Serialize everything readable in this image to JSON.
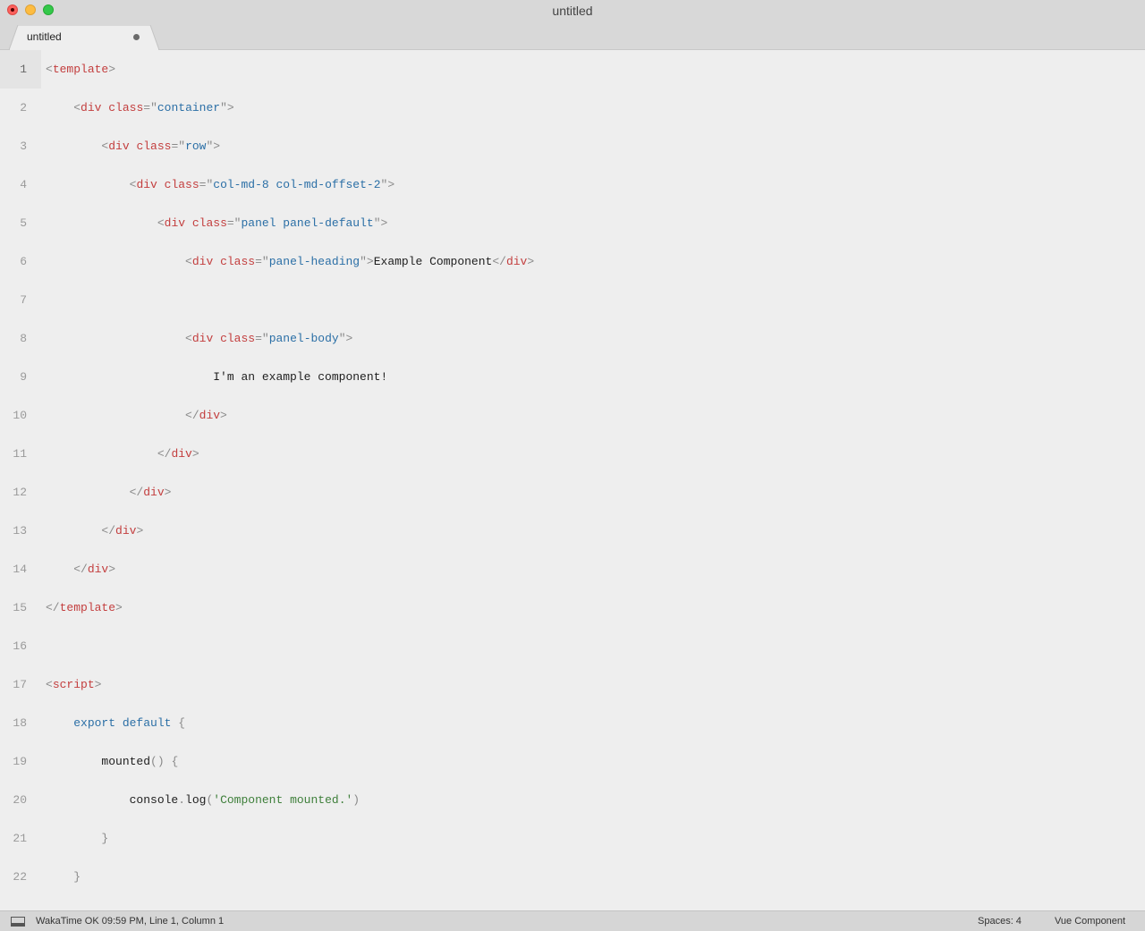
{
  "window": {
    "title": "untitled"
  },
  "tabs": [
    {
      "label": "untitled",
      "dirty": true
    }
  ],
  "code_lines": [
    {
      "n": "1",
      "tokens": [
        {
          "t": "<",
          "c": "punct"
        },
        {
          "t": "template",
          "c": "tag"
        },
        {
          "t": ">",
          "c": "punct"
        }
      ]
    },
    {
      "n": "2",
      "tokens": [
        {
          "t": "    ",
          "c": "txt"
        },
        {
          "t": "<",
          "c": "punct"
        },
        {
          "t": "div",
          "c": "tag"
        },
        {
          "t": " ",
          "c": "txt"
        },
        {
          "t": "class",
          "c": "attr"
        },
        {
          "t": "=\"",
          "c": "punct"
        },
        {
          "t": "container",
          "c": "str"
        },
        {
          "t": "\">",
          "c": "punct"
        }
      ]
    },
    {
      "n": "3",
      "tokens": [
        {
          "t": "        ",
          "c": "txt"
        },
        {
          "t": "<",
          "c": "punct"
        },
        {
          "t": "div",
          "c": "tag"
        },
        {
          "t": " ",
          "c": "txt"
        },
        {
          "t": "class",
          "c": "attr"
        },
        {
          "t": "=\"",
          "c": "punct"
        },
        {
          "t": "row",
          "c": "str"
        },
        {
          "t": "\">",
          "c": "punct"
        }
      ]
    },
    {
      "n": "4",
      "tokens": [
        {
          "t": "            ",
          "c": "txt"
        },
        {
          "t": "<",
          "c": "punct"
        },
        {
          "t": "div",
          "c": "tag"
        },
        {
          "t": " ",
          "c": "txt"
        },
        {
          "t": "class",
          "c": "attr"
        },
        {
          "t": "=\"",
          "c": "punct"
        },
        {
          "t": "col-md-8 col-md-offset-2",
          "c": "str"
        },
        {
          "t": "\">",
          "c": "punct"
        }
      ]
    },
    {
      "n": "5",
      "tokens": [
        {
          "t": "                ",
          "c": "txt"
        },
        {
          "t": "<",
          "c": "punct"
        },
        {
          "t": "div",
          "c": "tag"
        },
        {
          "t": " ",
          "c": "txt"
        },
        {
          "t": "class",
          "c": "attr"
        },
        {
          "t": "=\"",
          "c": "punct"
        },
        {
          "t": "panel panel-default",
          "c": "str"
        },
        {
          "t": "\">",
          "c": "punct"
        }
      ]
    },
    {
      "n": "6",
      "tokens": [
        {
          "t": "                    ",
          "c": "txt"
        },
        {
          "t": "<",
          "c": "punct"
        },
        {
          "t": "div",
          "c": "tag"
        },
        {
          "t": " ",
          "c": "txt"
        },
        {
          "t": "class",
          "c": "attr"
        },
        {
          "t": "=\"",
          "c": "punct"
        },
        {
          "t": "panel-heading",
          "c": "str"
        },
        {
          "t": "\">",
          "c": "punct"
        },
        {
          "t": "Example Component",
          "c": "txt"
        },
        {
          "t": "</",
          "c": "punct"
        },
        {
          "t": "div",
          "c": "tag"
        },
        {
          "t": ">",
          "c": "punct"
        }
      ]
    },
    {
      "n": "7",
      "tokens": []
    },
    {
      "n": "8",
      "tokens": [
        {
          "t": "                    ",
          "c": "txt"
        },
        {
          "t": "<",
          "c": "punct"
        },
        {
          "t": "div",
          "c": "tag"
        },
        {
          "t": " ",
          "c": "txt"
        },
        {
          "t": "class",
          "c": "attr"
        },
        {
          "t": "=\"",
          "c": "punct"
        },
        {
          "t": "panel-body",
          "c": "str"
        },
        {
          "t": "\">",
          "c": "punct"
        }
      ]
    },
    {
      "n": "9",
      "tokens": [
        {
          "t": "                        ",
          "c": "txt"
        },
        {
          "t": "I'm an example component!",
          "c": "txt"
        }
      ]
    },
    {
      "n": "10",
      "tokens": [
        {
          "t": "                    ",
          "c": "txt"
        },
        {
          "t": "</",
          "c": "punct"
        },
        {
          "t": "div",
          "c": "tag"
        },
        {
          "t": ">",
          "c": "punct"
        }
      ]
    },
    {
      "n": "11",
      "tokens": [
        {
          "t": "                ",
          "c": "txt"
        },
        {
          "t": "</",
          "c": "punct"
        },
        {
          "t": "div",
          "c": "tag"
        },
        {
          "t": ">",
          "c": "punct"
        }
      ]
    },
    {
      "n": "12",
      "tokens": [
        {
          "t": "            ",
          "c": "txt"
        },
        {
          "t": "</",
          "c": "punct"
        },
        {
          "t": "div",
          "c": "tag"
        },
        {
          "t": ">",
          "c": "punct"
        }
      ]
    },
    {
      "n": "13",
      "tokens": [
        {
          "t": "        ",
          "c": "txt"
        },
        {
          "t": "</",
          "c": "punct"
        },
        {
          "t": "div",
          "c": "tag"
        },
        {
          "t": ">",
          "c": "punct"
        }
      ]
    },
    {
      "n": "14",
      "tokens": [
        {
          "t": "    ",
          "c": "txt"
        },
        {
          "t": "</",
          "c": "punct"
        },
        {
          "t": "div",
          "c": "tag"
        },
        {
          "t": ">",
          "c": "punct"
        }
      ]
    },
    {
      "n": "15",
      "tokens": [
        {
          "t": "</",
          "c": "punct"
        },
        {
          "t": "template",
          "c": "tag"
        },
        {
          "t": ">",
          "c": "punct"
        }
      ]
    },
    {
      "n": "16",
      "tokens": []
    },
    {
      "n": "17",
      "tokens": [
        {
          "t": "<",
          "c": "punct"
        },
        {
          "t": "script",
          "c": "tag"
        },
        {
          "t": ">",
          "c": "punct"
        }
      ]
    },
    {
      "n": "18",
      "tokens": [
        {
          "t": "    ",
          "c": "txt"
        },
        {
          "t": "export default",
          "c": "kw"
        },
        {
          "t": " ",
          "c": "txt"
        },
        {
          "t": "{",
          "c": "punct"
        }
      ]
    },
    {
      "n": "19",
      "tokens": [
        {
          "t": "        ",
          "c": "txt"
        },
        {
          "t": "mounted",
          "c": "fn"
        },
        {
          "t": "()",
          "c": "punct"
        },
        {
          "t": " ",
          "c": "txt"
        },
        {
          "t": "{",
          "c": "punct"
        }
      ]
    },
    {
      "n": "20",
      "tokens": [
        {
          "t": "            ",
          "c": "txt"
        },
        {
          "t": "console",
          "c": "fn"
        },
        {
          "t": ".",
          "c": "punct"
        },
        {
          "t": "log",
          "c": "fn"
        },
        {
          "t": "(",
          "c": "punct"
        },
        {
          "t": "'Component mounted.'",
          "c": "str2"
        },
        {
          "t": ")",
          "c": "punct"
        }
      ]
    },
    {
      "n": "21",
      "tokens": [
        {
          "t": "        ",
          "c": "txt"
        },
        {
          "t": "}",
          "c": "punct"
        }
      ]
    },
    {
      "n": "22",
      "tokens": [
        {
          "t": "    ",
          "c": "txt"
        },
        {
          "t": "}",
          "c": "punct"
        }
      ]
    }
  ],
  "status": {
    "left_text": "WakaTime OK 09:59 PM, Line 1, Column 1",
    "spaces": "Spaces: 4",
    "syntax": "Vue Component"
  },
  "icons": {
    "close": "window-close-icon",
    "minimize": "window-minimize-icon",
    "maximize": "window-maximize-icon",
    "dirty": "unsaved-dot-icon",
    "panel": "panel-toggle-icon"
  },
  "colors": {
    "tag": "#c33e3e",
    "string": "#2b6fa6",
    "punctuation": "#8a8a8a",
    "js_string": "#3e7f3a",
    "background": "#eeeeee"
  }
}
